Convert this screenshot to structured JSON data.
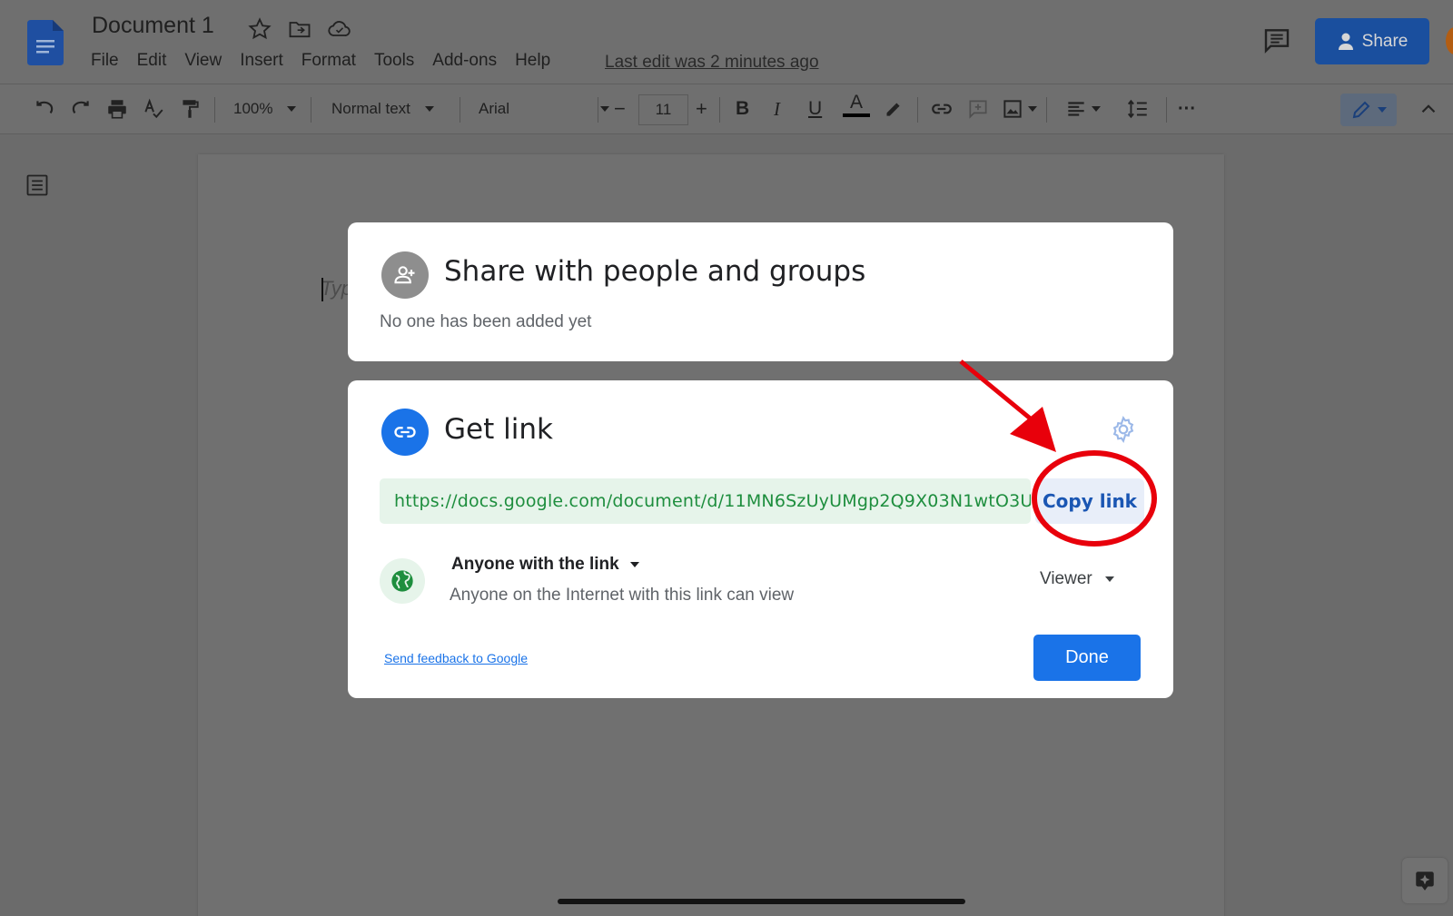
{
  "app": {
    "doc_title": "Document 1",
    "menu": [
      "File",
      "Edit",
      "View",
      "Insert",
      "Format",
      "Tools",
      "Add-ons",
      "Help"
    ],
    "last_edit": "Last edit was 2 minutes ago",
    "share_label": "Share"
  },
  "toolbar": {
    "zoom": "100%",
    "style": "Normal text",
    "font": "Arial",
    "font_size": "11",
    "bold": "B",
    "italic": "I",
    "underline": "U",
    "text_color": "A",
    "minus": "−",
    "plus": "+",
    "more": "···"
  },
  "document": {
    "placeholder": "Typ"
  },
  "share_card": {
    "title": "Share with people and groups",
    "subtitle": "No one has been added yet"
  },
  "link_card": {
    "title": "Get link",
    "url": "https://docs.google.com/document/d/11MN6SzUyUMgp2Q9X03N1wtO3U…",
    "copy_label": "Copy link",
    "access_label": "Anyone with the link",
    "access_desc": "Anyone on the Internet with this link can view",
    "role": "Viewer",
    "feedback": "Send feedback to Google",
    "done_label": "Done"
  },
  "colors": {
    "accent": "#1a73e8",
    "link_green": "#1e8e3e",
    "annotation_red": "#e8000b"
  }
}
